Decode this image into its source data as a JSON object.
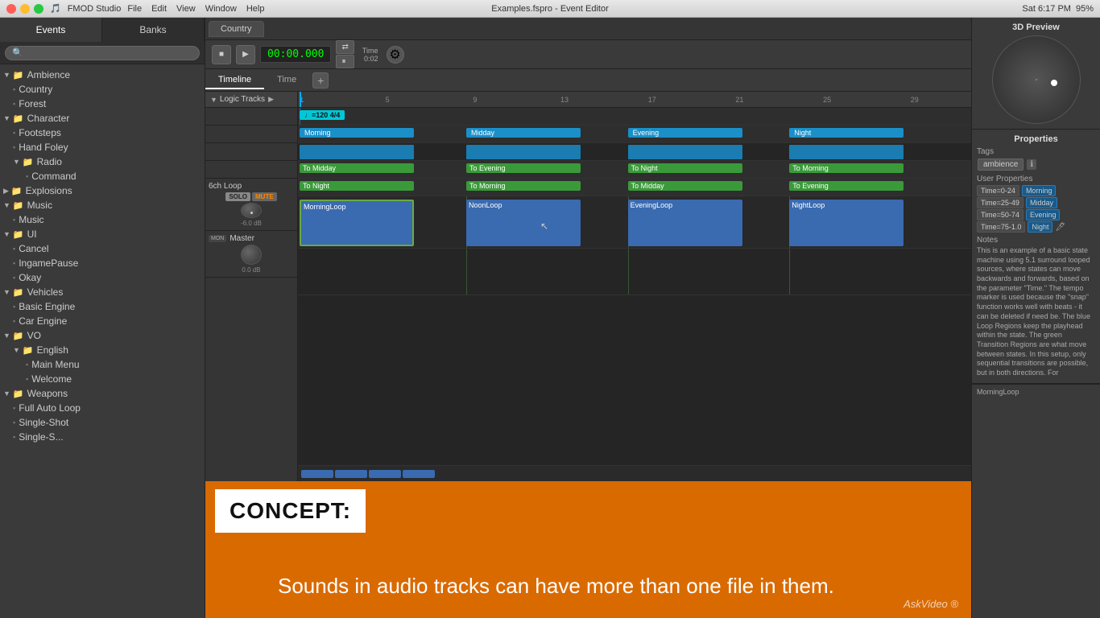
{
  "titlebar": {
    "app_name": "FMOD Studio",
    "menus": [
      "File",
      "Edit",
      "View",
      "Window",
      "Help"
    ],
    "title": "Examples.fspro - Event Editor",
    "time": "Sat 6:17 PM",
    "battery": "95%"
  },
  "sidebar": {
    "tabs": [
      "Events",
      "Banks"
    ],
    "search_placeholder": "",
    "tree": [
      {
        "id": "ambience",
        "label": "Ambience",
        "type": "folder",
        "expanded": true,
        "indent": 0
      },
      {
        "id": "country",
        "label": "Country",
        "type": "file",
        "indent": 1
      },
      {
        "id": "forest",
        "label": "Forest",
        "type": "file",
        "indent": 1
      },
      {
        "id": "character",
        "label": "Character",
        "type": "folder",
        "expanded": true,
        "indent": 0
      },
      {
        "id": "footsteps",
        "label": "Footsteps",
        "type": "file",
        "indent": 1
      },
      {
        "id": "hand-foley",
        "label": "Hand Foley",
        "type": "file",
        "indent": 1
      },
      {
        "id": "radio",
        "label": "Radio",
        "type": "folder",
        "expanded": true,
        "indent": 1
      },
      {
        "id": "command",
        "label": "Command",
        "type": "file",
        "indent": 2
      },
      {
        "id": "explosions",
        "label": "Explosions",
        "type": "folder",
        "expanded": false,
        "indent": 0
      },
      {
        "id": "music",
        "label": "Music",
        "type": "folder",
        "expanded": true,
        "indent": 0
      },
      {
        "id": "music-item",
        "label": "Music",
        "type": "file",
        "indent": 1
      },
      {
        "id": "ui",
        "label": "UI",
        "type": "folder",
        "expanded": true,
        "indent": 0
      },
      {
        "id": "cancel",
        "label": "Cancel",
        "type": "file",
        "indent": 1
      },
      {
        "id": "ingamepause",
        "label": "IngamePause",
        "type": "file",
        "indent": 1
      },
      {
        "id": "okay",
        "label": "Okay",
        "type": "file",
        "indent": 1
      },
      {
        "id": "vehicles",
        "label": "Vehicles",
        "type": "folder",
        "expanded": true,
        "indent": 0
      },
      {
        "id": "basic-engine",
        "label": "Basic Engine",
        "type": "file",
        "indent": 1
      },
      {
        "id": "car-engine",
        "label": "Car Engine",
        "type": "file",
        "indent": 1
      },
      {
        "id": "vo",
        "label": "VO",
        "type": "folder",
        "expanded": true,
        "indent": 0
      },
      {
        "id": "english",
        "label": "English",
        "type": "folder",
        "expanded": true,
        "indent": 1
      },
      {
        "id": "main-menu",
        "label": "Main Menu",
        "type": "file",
        "indent": 2
      },
      {
        "id": "welcome",
        "label": "Welcome",
        "type": "file",
        "indent": 2
      },
      {
        "id": "weapons",
        "label": "Weapons",
        "type": "folder",
        "expanded": true,
        "indent": 0
      },
      {
        "id": "full-auto-loop",
        "label": "Full Auto Loop",
        "type": "file",
        "indent": 1
      },
      {
        "id": "single-shot",
        "label": "Single-Shot",
        "type": "file",
        "indent": 1
      },
      {
        "id": "single-s",
        "label": "Single-S...",
        "type": "file",
        "indent": 1
      }
    ]
  },
  "editor": {
    "tab_label": "Country",
    "time_display": "00:00.000",
    "timeline_tab": "Timeline",
    "time_tab": "Time",
    "logic_tracks_label": "Logic Tracks",
    "tracks": {
      "loop_track": {
        "label": "6ch Loop",
        "solo": "SOLO",
        "mute": "MUTE",
        "volume": "-6.0 dB",
        "clips": [
          {
            "label": "MorningLoop",
            "color": "loop",
            "left_pct": 0,
            "width_pct": 18
          },
          {
            "label": "NoonLoop",
            "color": "loop",
            "left_pct": 24,
            "width_pct": 18
          },
          {
            "label": "EveningLoop",
            "color": "loop",
            "left_pct": 48,
            "width_pct": 18
          },
          {
            "label": "NightLoop",
            "color": "loop",
            "left_pct": 72,
            "width_pct": 18
          }
        ]
      },
      "master_track": {
        "label": "Master",
        "mon": "MON",
        "volume": "0.0 dB"
      }
    },
    "logic_clips": {
      "tempo": {
        "label": "♩=120 4/4",
        "color": "teal"
      },
      "states": [
        {
          "label": "Morning",
          "color": "blue",
          "left_pct": 0,
          "width_pct": 18
        },
        {
          "label": "Midday",
          "color": "blue",
          "left_pct": 24,
          "width_pct": 18
        },
        {
          "label": "Evening",
          "color": "blue",
          "left_pct": 48,
          "width_pct": 18
        },
        {
          "label": "Night",
          "color": "blue",
          "left_pct": 72,
          "width_pct": 18
        }
      ],
      "transitions1": [
        {
          "label": "To Midday",
          "color": "green",
          "left_pct": 0,
          "width_pct": 18
        },
        {
          "label": "To Evening",
          "color": "green",
          "left_pct": 24,
          "width_pct": 18
        },
        {
          "label": "To Night",
          "color": "green",
          "left_pct": 48,
          "width_pct": 18
        },
        {
          "label": "To Morning",
          "color": "green",
          "left_pct": 72,
          "width_pct": 18
        }
      ],
      "transitions2": [
        {
          "label": "To Night",
          "color": "green",
          "left_pct": 0,
          "width_pct": 18
        },
        {
          "label": "To Morning",
          "color": "green",
          "left_pct": 24,
          "width_pct": 18
        },
        {
          "label": "To Midday",
          "color": "green",
          "left_pct": 48,
          "width_pct": 18
        },
        {
          "label": "To Evening",
          "color": "green",
          "left_pct": 72,
          "width_pct": 18
        }
      ]
    },
    "ruler_marks": [
      "1",
      "5",
      "9",
      "13",
      "17",
      "21",
      "25",
      "29"
    ]
  },
  "right_panel": {
    "preview_title": "3D Preview",
    "properties_title": "Properties",
    "tags_label": "Tags",
    "tag_value": "ambience",
    "user_props_label": "User Properties",
    "user_props": [
      {
        "key": "Time=0-24",
        "value": "Morning"
      },
      {
        "key": "Time=25-49",
        "value": "Midday"
      },
      {
        "key": "Time=50-74",
        "value": "Evening"
      },
      {
        "key": "Time=75-1.0",
        "value": "Night"
      }
    ],
    "notes_label": "Notes",
    "notes_text": "This is an example of a basic state machine using 5.1 surround looped sources, where states can move backwards and forwards, based on the parameter 'Time.'\n\nThe tempo marker is used because the 'snap' function works well with beats - it can be deleted if need be. The blue Loop Regions keep the playhead within the state. The green Transition Regions are what move between states. In this setup, only sequential transitions are possible, but in both directions. For",
    "bottom_label": "MorningLoop"
  },
  "bottom_bar": {
    "concept_label": "CONCEPT:",
    "subtitle": "Sounds in audio tracks can have more than one file in them.",
    "logo": "AskVideo"
  }
}
